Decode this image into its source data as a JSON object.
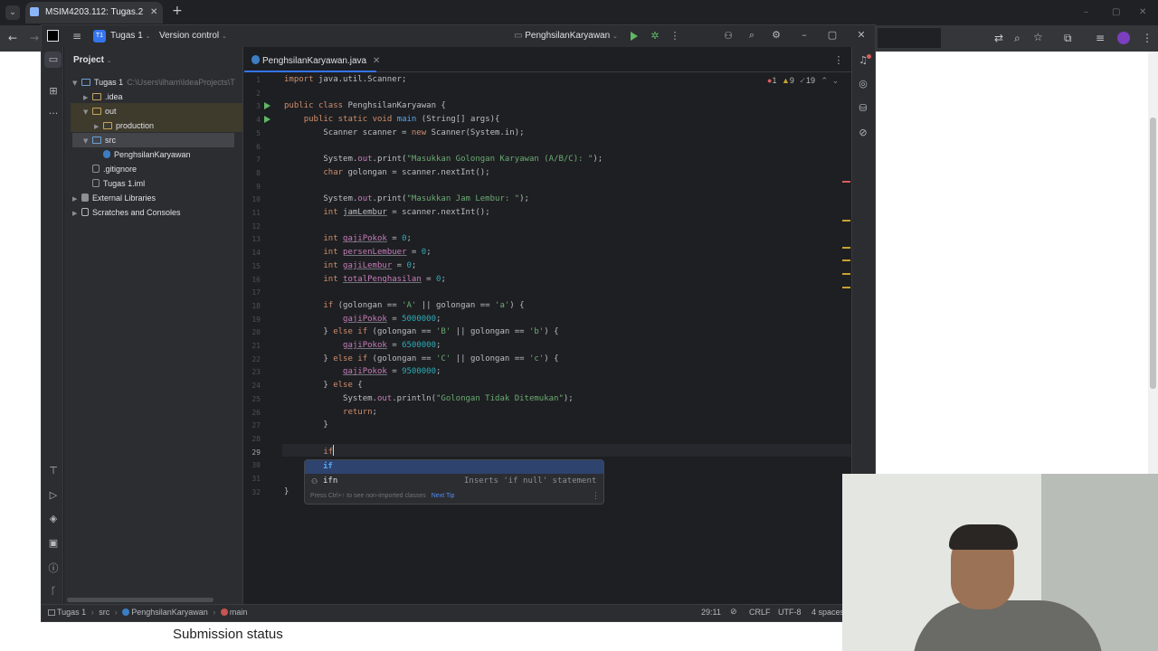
{
  "browser": {
    "tab_title": "MSIM4203.112: Tugas.2",
    "tab_close": "✕",
    "new_tab": "+",
    "window_min": "–",
    "window_restore": "▢",
    "window_close": "✕"
  },
  "web_page": {
    "heading": "Submission status"
  },
  "ide": {
    "project_badge": "T1",
    "project_name": "Tugas 1",
    "vcs_label": "Version control",
    "run_config": "PenghsilanKaryawan",
    "panel_title": "Project",
    "editor_tab": "PenghsilanKaryawan.java",
    "inspections": {
      "errors": "1",
      "warnings": "9",
      "weak": "19"
    }
  },
  "project_tree": [
    {
      "label": "Tugas 1",
      "hint": "C:\\Users\\ilham\\IdeaProjects\\T",
      "indent": 0,
      "kind": "folder-blue",
      "arrow": "open"
    },
    {
      "label": ".idea",
      "hint": "",
      "indent": 1,
      "kind": "folder",
      "arrow": "closed"
    },
    {
      "label": "out",
      "hint": "",
      "indent": 1,
      "kind": "folder",
      "arrow": "open"
    },
    {
      "label": "production",
      "hint": "",
      "indent": 2,
      "kind": "folder",
      "arrow": "closed"
    },
    {
      "label": "src",
      "hint": "",
      "indent": 1,
      "kind": "folder-blue",
      "arrow": "open"
    },
    {
      "label": "PenghsilanKaryawan",
      "hint": "",
      "indent": 2,
      "kind": "class",
      "arrow": ""
    },
    {
      "label": ".gitignore",
      "hint": "",
      "indent": 1,
      "kind": "file",
      "arrow": ""
    },
    {
      "label": "Tugas 1.iml",
      "hint": "",
      "indent": 1,
      "kind": "file",
      "arrow": ""
    },
    {
      "label": "External Libraries",
      "hint": "",
      "indent": 0,
      "kind": "lib",
      "arrow": "closed"
    },
    {
      "label": "Scratches and Consoles",
      "hint": "",
      "indent": 0,
      "kind": "scratch",
      "arrow": "closed"
    }
  ],
  "code_lines": [
    "import java.util.Scanner;",
    "",
    "public class PenghsilanKaryawan {",
    "    public static void main (String[] args){",
    "        Scanner scanner = new Scanner(System.in);",
    "",
    "        System.out.print(\"Masukkan Golongan Karyawan (A/B/C): \");",
    "        char golongan = scanner.nextInt();",
    "",
    "        System.out.print(\"Masukkan Jam Lembur: \");",
    "        int jamLembur = scanner.nextInt();",
    "",
    "        int gajiPokok = 0;",
    "        int persenLembuer = 0;",
    "        int gajiLembur = 0;",
    "        int totalPenghasilan = 0;",
    "",
    "        if (golongan == 'A' || golongan == 'a') {",
    "            gajiPokok = 5000000;",
    "        } else if (golongan == 'B' || golongan == 'b') {",
    "            gajiPokok = 6500000;",
    "        } else if (golongan == 'C' || golongan == 'c') {",
    "            gajiPokok = 9500000;",
    "        } else {",
    "            System.out.println(\"Golongan Tidak Ditemukan\");",
    "            return;",
    "        }",
    "",
    "        if",
    "",
    "",
    "}"
  ],
  "completion": {
    "item1": "if",
    "item2": "ifn",
    "item2_hint": "Inserts 'if null' statement",
    "footer": "Press Ctrl+↑ to see non-imported classes",
    "footer_link": "Next Tip"
  },
  "statusbar": {
    "crumbs": [
      "Tugas 1",
      "src",
      "PenghsilanKaryawan",
      "main"
    ],
    "position": "29:11",
    "line_sep": "CRLF",
    "encoding": "UTF-8",
    "indent": "4 spaces"
  },
  "colors": {
    "accent": "#3574f0",
    "selection": "#2e436e",
    "keyword": "#cf8e6d",
    "string": "#6aab73",
    "error": "#db5c5c",
    "warning": "#c7a22f"
  }
}
